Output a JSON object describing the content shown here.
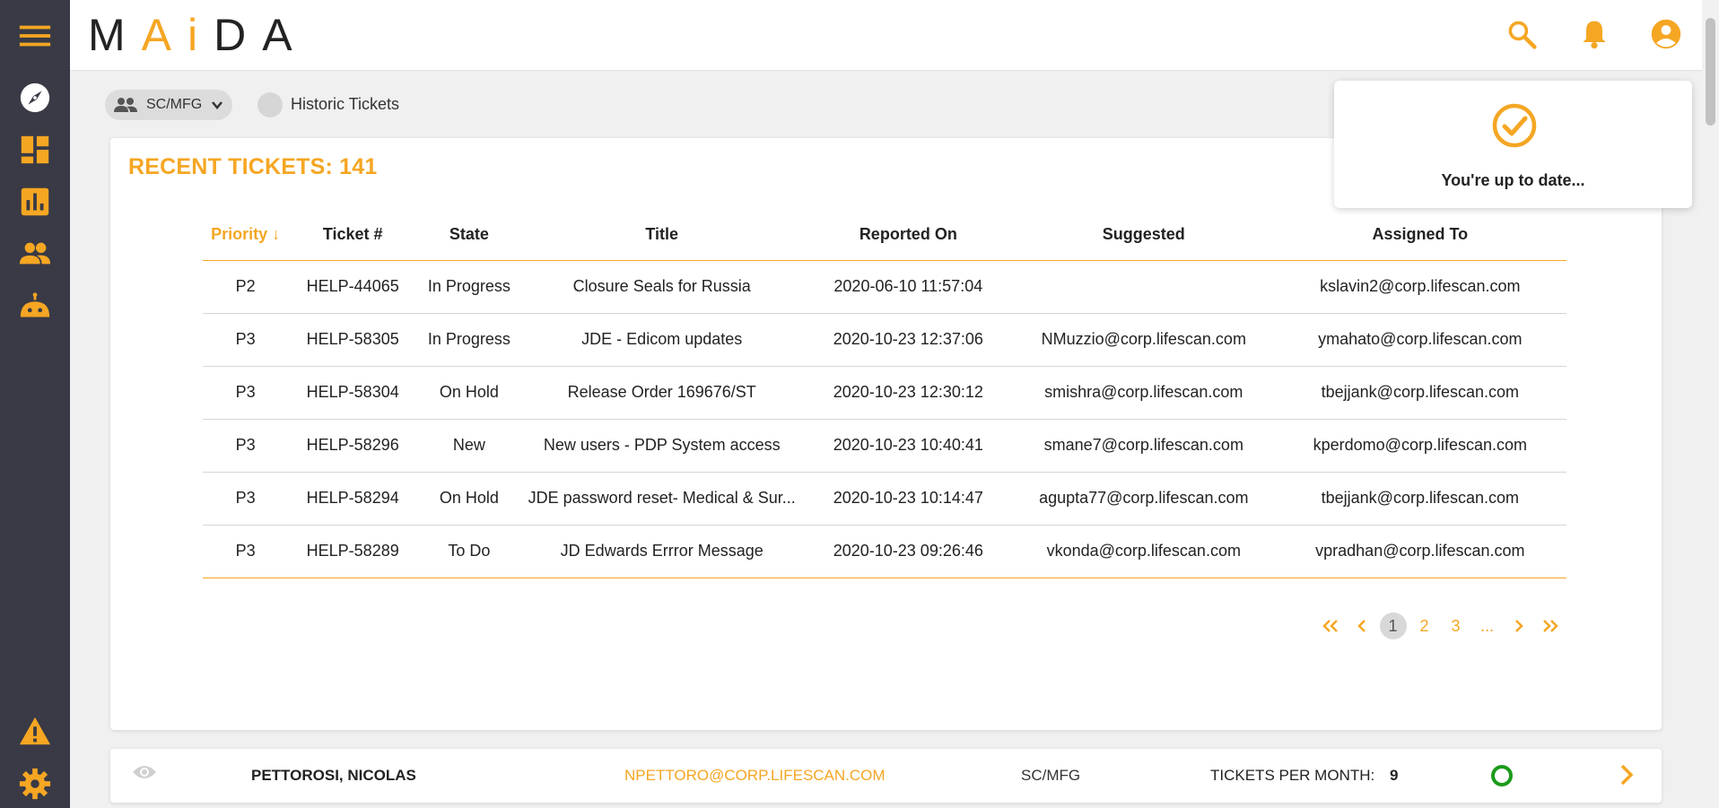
{
  "app": {
    "logo_text": "MAiDA",
    "accent_color": "#f5a623",
    "sidebar_color": "#393a45"
  },
  "sidebar": {
    "items": [
      {
        "name": "menu-icon"
      },
      {
        "name": "compass-icon"
      },
      {
        "name": "dashboard-icon"
      },
      {
        "name": "bar-chart-icon"
      },
      {
        "name": "people-icon"
      },
      {
        "name": "robot-icon"
      },
      {
        "name": "warning-icon"
      },
      {
        "name": "gear-icon"
      }
    ]
  },
  "header": {
    "icons": [
      "search-icon",
      "bell-icon",
      "account-icon"
    ]
  },
  "filters": {
    "team_label": "SC/MFG",
    "historic_label": "Historic Tickets",
    "historic_enabled": false
  },
  "tickets_card": {
    "title": "RECENT TICKETS: 141",
    "columns": [
      "Priority",
      "Ticket #",
      "State",
      "Title",
      "Reported On",
      "Suggested",
      "Assigned To"
    ],
    "sort_arrow": "↓",
    "rows": [
      {
        "priority": "P2",
        "ticket": "HELP-44065",
        "state": "In Progress",
        "title": "Closure Seals for Russia",
        "reported": "2020-06-10 11:57:04",
        "suggested": "",
        "assigned": "kslavin2@corp.lifescan.com"
      },
      {
        "priority": "P3",
        "ticket": "HELP-58305",
        "state": "In Progress",
        "title": "JDE - Edicom updates",
        "reported": "2020-10-23 12:37:06",
        "suggested": "NMuzzio@corp.lifescan.com",
        "assigned": "ymahato@corp.lifescan.com"
      },
      {
        "priority": "P3",
        "ticket": "HELP-58304",
        "state": "On Hold",
        "title": "Release Order 169676/ST",
        "reported": "2020-10-23 12:30:12",
        "suggested": "smishra@corp.lifescan.com",
        "assigned": "tbejjank@corp.lifescan.com"
      },
      {
        "priority": "P3",
        "ticket": "HELP-58296",
        "state": "New",
        "title": "New users - PDP System access",
        "reported": "2020-10-23 10:40:41",
        "suggested": "smane7@corp.lifescan.com",
        "assigned": "kperdomo@corp.lifescan.com"
      },
      {
        "priority": "P3",
        "ticket": "HELP-58294",
        "state": "On Hold",
        "title": "JDE password reset- Medical & Sur...",
        "reported": "2020-10-23 10:14:47",
        "suggested": "agupta77@corp.lifescan.com",
        "assigned": "tbejjank@corp.lifescan.com"
      },
      {
        "priority": "P3",
        "ticket": "HELP-58289",
        "state": "To Do",
        "title": "JD Edwards Errror Message",
        "reported": "2020-10-23 09:26:46",
        "suggested": "vkonda@corp.lifescan.com",
        "assigned": "vpradhan@corp.lifescan.com"
      }
    ],
    "pagination": {
      "first": "«",
      "prev": "‹",
      "pages": [
        "1",
        "2",
        "3",
        "..."
      ],
      "current": "1",
      "next": "›",
      "last": "»"
    }
  },
  "notification": {
    "message": "You're up to date..."
  },
  "user_row": {
    "name": "PETTOROSI, NICOLAS",
    "email": "NPETTORO@CORP.LIFESCAN.COM",
    "team": "SC/MFG",
    "tickets_per_month_label": "TICKETS PER MONTH:",
    "tickets_per_month_value": "9",
    "status_color": "#1b9b1b"
  }
}
